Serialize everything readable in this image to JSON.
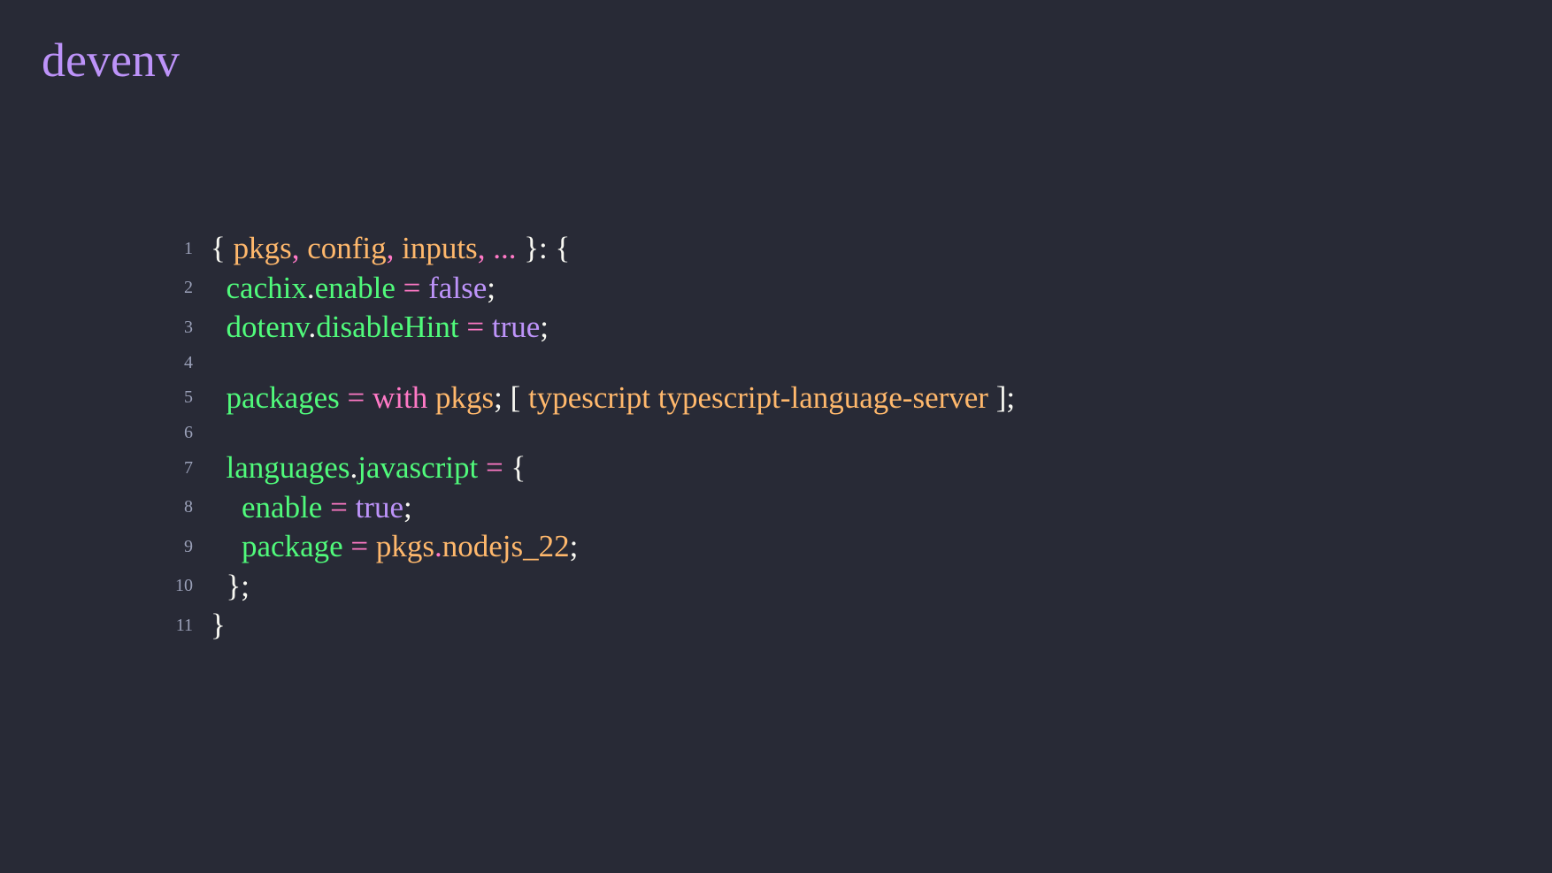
{
  "slide": {
    "title": "devenv"
  },
  "colors": {
    "background": "#282a36",
    "title": "#bd93f9",
    "line_number": "#9aa0b8",
    "punctuation": "#f8f8f2",
    "parameter": "#ffb86c",
    "operator": "#ff79c6",
    "attribute": "#50fa7b",
    "boolean": "#bd93f9",
    "keyword": "#ff79c6"
  },
  "code": {
    "language": "nix",
    "lines": [
      {
        "number": "1",
        "tokens": [
          {
            "text": "{ ",
            "kind": "punct"
          },
          {
            "text": "pkgs",
            "kind": "param"
          },
          {
            "text": ", ",
            "kind": "op"
          },
          {
            "text": "config",
            "kind": "param"
          },
          {
            "text": ", ",
            "kind": "op"
          },
          {
            "text": "inputs",
            "kind": "param"
          },
          {
            "text": ", ",
            "kind": "op"
          },
          {
            "text": "...",
            "kind": "op"
          },
          {
            "text": " }: {",
            "kind": "punct"
          }
        ]
      },
      {
        "number": "2",
        "tokens": [
          {
            "text": "  ",
            "kind": "punct"
          },
          {
            "text": "cachix",
            "kind": "attr"
          },
          {
            "text": ".",
            "kind": "punct"
          },
          {
            "text": "enable",
            "kind": "attr"
          },
          {
            "text": " = ",
            "kind": "op"
          },
          {
            "text": "false",
            "kind": "bool"
          },
          {
            "text": ";",
            "kind": "punct"
          }
        ]
      },
      {
        "number": "3",
        "tokens": [
          {
            "text": "  ",
            "kind": "punct"
          },
          {
            "text": "dotenv",
            "kind": "attr"
          },
          {
            "text": ".",
            "kind": "punct"
          },
          {
            "text": "disableHint",
            "kind": "attr"
          },
          {
            "text": " = ",
            "kind": "op"
          },
          {
            "text": "true",
            "kind": "bool"
          },
          {
            "text": ";",
            "kind": "punct"
          }
        ]
      },
      {
        "number": "4",
        "tokens": []
      },
      {
        "number": "5",
        "tokens": [
          {
            "text": "  ",
            "kind": "punct"
          },
          {
            "text": "packages",
            "kind": "attr"
          },
          {
            "text": " = ",
            "kind": "op"
          },
          {
            "text": "with",
            "kind": "kw"
          },
          {
            "text": " ",
            "kind": "punct"
          },
          {
            "text": "pkgs",
            "kind": "param"
          },
          {
            "text": "; [ ",
            "kind": "punct"
          },
          {
            "text": "typescript",
            "kind": "param"
          },
          {
            "text": " ",
            "kind": "punct"
          },
          {
            "text": "typescript-language-server",
            "kind": "param"
          },
          {
            "text": " ];",
            "kind": "punct"
          }
        ]
      },
      {
        "number": "6",
        "tokens": []
      },
      {
        "number": "7",
        "tokens": [
          {
            "text": "  ",
            "kind": "punct"
          },
          {
            "text": "languages",
            "kind": "attr"
          },
          {
            "text": ".",
            "kind": "punct"
          },
          {
            "text": "javascript",
            "kind": "attr"
          },
          {
            "text": " = ",
            "kind": "op"
          },
          {
            "text": "{",
            "kind": "punct"
          }
        ]
      },
      {
        "number": "8",
        "tokens": [
          {
            "text": "    ",
            "kind": "punct"
          },
          {
            "text": "enable",
            "kind": "attr"
          },
          {
            "text": " = ",
            "kind": "op"
          },
          {
            "text": "true",
            "kind": "bool"
          },
          {
            "text": ";",
            "kind": "punct"
          }
        ]
      },
      {
        "number": "9",
        "tokens": [
          {
            "text": "    ",
            "kind": "punct"
          },
          {
            "text": "package",
            "kind": "attr"
          },
          {
            "text": " = ",
            "kind": "op"
          },
          {
            "text": "pkgs",
            "kind": "param"
          },
          {
            "text": ".",
            "kind": "op"
          },
          {
            "text": "nodejs_22",
            "kind": "param"
          },
          {
            "text": ";",
            "kind": "punct"
          }
        ]
      },
      {
        "number": "10",
        "tokens": [
          {
            "text": "  };",
            "kind": "punct"
          }
        ]
      },
      {
        "number": "11",
        "tokens": [
          {
            "text": "}",
            "kind": "punct"
          }
        ]
      }
    ]
  }
}
